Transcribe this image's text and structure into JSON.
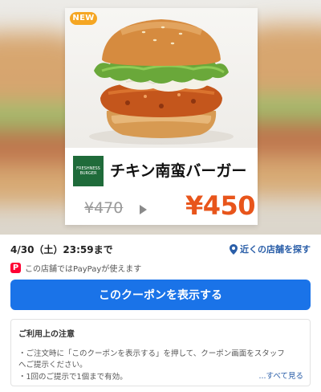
{
  "coupon": {
    "badge": "NEW",
    "brand_logo_text": "FRESHNESS BURGER",
    "product_name": "チキン南蛮バーガー",
    "original_price": "¥470",
    "sale_price": "¥450"
  },
  "info": {
    "expiry": "4/30（土）23:59まで",
    "nearby_store_link": "近くの店舗を探す",
    "paypay_note": "この店舗ではPayPayが使えます",
    "paypay_icon_letter": "P"
  },
  "actions": {
    "show_coupon_button": "このクーポンを表示する"
  },
  "notes": {
    "title": "ご利用上の注意",
    "lines": [
      "・ご注文時に「このクーポンを表示する」を押して、クーポン画面をスタッフ",
      "へご提示ください。",
      "・1回のご提示で1個まで有効。"
    ],
    "see_all_link": "...すべて見る"
  },
  "colors": {
    "accent_blue": "#1a73e8",
    "price_orange": "#e8551b",
    "badge_orange": "#f5a623",
    "brand_green": "#1f6b3a",
    "paypay_red": "#ff0033"
  }
}
